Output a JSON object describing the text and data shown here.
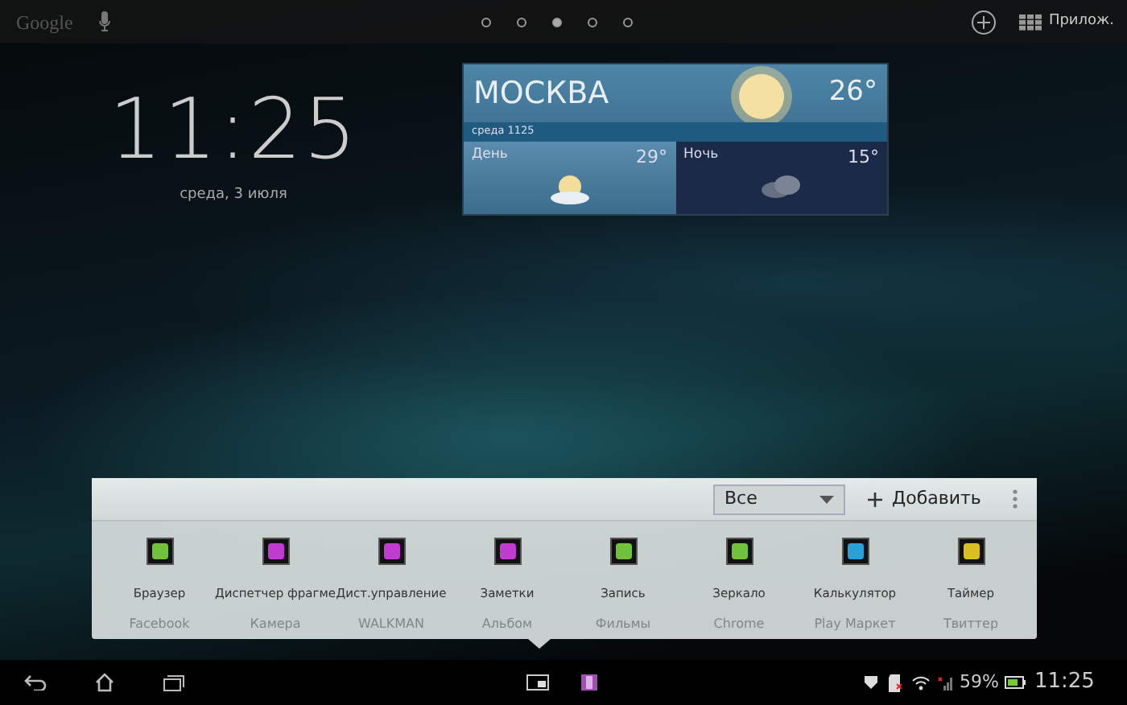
{
  "top_bar": {
    "search_label": "Google",
    "apps_label": "Прилож.",
    "pages": [
      {
        "selected": false
      },
      {
        "selected": false
      },
      {
        "selected": true
      },
      {
        "selected": false
      },
      {
        "selected": false
      }
    ]
  },
  "clock": {
    "time": "11:25",
    "date": "среда, 3 июля"
  },
  "weather": {
    "city": "МОСКВА",
    "temperature": "26°",
    "updated": "среда 1125",
    "day_label": "День",
    "day_temperature": "29°",
    "night_label": "Ночь",
    "night_temperature": "15°"
  },
  "small_apps_panel": {
    "filter": "Все",
    "add_label": "Добавить",
    "apps": [
      {
        "label": "Браузер",
        "color": "#6fc23a"
      },
      {
        "label": "Диспетчер фрагме",
        "color": "#c03cd0"
      },
      {
        "label": "Дист.управление",
        "color": "#c03cd0"
      },
      {
        "label": "Заметки",
        "color": "#c03cd0"
      },
      {
        "label": "Запись",
        "color": "#6fc23a"
      },
      {
        "label": "Зеркало",
        "color": "#6fc23a"
      },
      {
        "label": "Калькулятор",
        "color": "#2aa0d8"
      },
      {
        "label": "Таймер",
        "color": "#d8c020"
      }
    ],
    "dock_labels": [
      "Facebook",
      "Камера",
      "WALKMAN",
      "Альбом",
      "Фильмы",
      "Chrome",
      "Play Маркет",
      "Твиттер"
    ]
  },
  "status_bar": {
    "battery": "59%",
    "time": "11:25"
  }
}
